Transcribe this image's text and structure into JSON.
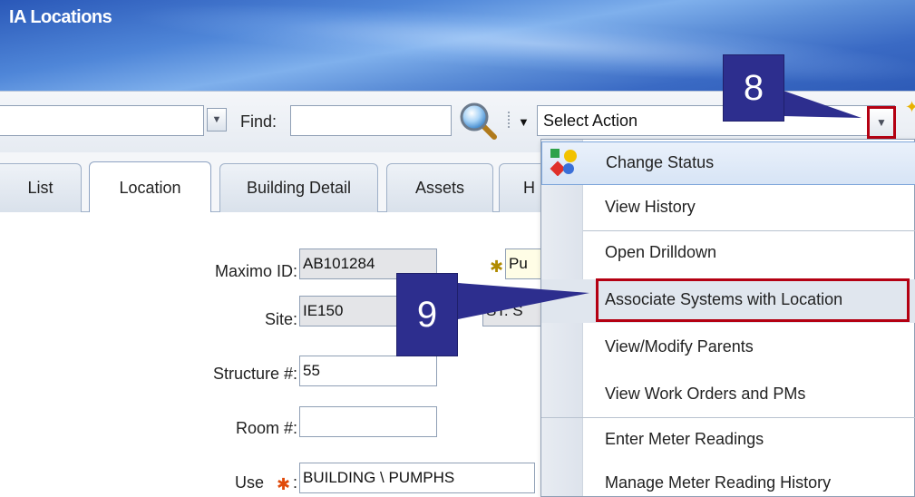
{
  "window": {
    "title": "IA Locations"
  },
  "toolbar": {
    "find_label": "Find:",
    "find_value": "",
    "select_action": "Select Action"
  },
  "tabs": [
    {
      "label": "List"
    },
    {
      "label": "Location",
      "active": true
    },
    {
      "label": "Building Detail"
    },
    {
      "label": "Assets"
    },
    {
      "label": "H"
    }
  ],
  "form": {
    "maximo_id": {
      "label": "Maximo ID:",
      "value": "AB101284"
    },
    "description": {
      "value": "Pu"
    },
    "site": {
      "label": "Site:",
      "value": "IE150"
    },
    "site_desc": {
      "value": "ST. S"
    },
    "structure": {
      "label": "Structure #:",
      "value": "55"
    },
    "room": {
      "label": "Room #:",
      "value": ""
    },
    "use": {
      "label": "Use",
      "value": "BUILDING \\ PUMPHS"
    }
  },
  "action_menu": {
    "items": [
      {
        "label": "Change Status"
      },
      {
        "label": "View History"
      },
      {
        "label": "Open Drilldown"
      },
      {
        "label": "Associate Systems with Location",
        "highlighted": true
      },
      {
        "label": "View/Modify Parents"
      },
      {
        "label": "View Work Orders and PMs"
      },
      {
        "label": "Enter Meter Readings"
      },
      {
        "label": "Manage Meter Reading History"
      }
    ]
  },
  "callouts": [
    {
      "label": "8"
    },
    {
      "label": "9"
    }
  ],
  "colors": {
    "callout": "#2d2e8e",
    "highlight_border": "#b40012",
    "banner": "#3a6ac4"
  }
}
